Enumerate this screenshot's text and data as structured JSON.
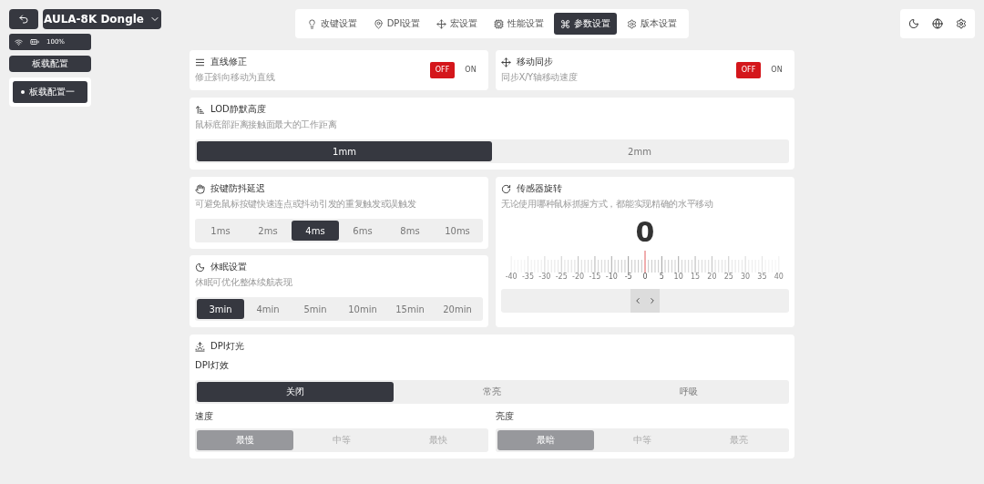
{
  "header": {
    "device": "AULA-8K Dongle",
    "battery": "100%"
  },
  "sidebar": {
    "button": "板载配置",
    "items": [
      {
        "label": "板载配置一",
        "selected": true
      }
    ]
  },
  "nav": [
    {
      "label": "改键设置",
      "selected": false
    },
    {
      "label": "DPI设置",
      "selected": false
    },
    {
      "label": "宏设置",
      "selected": false
    },
    {
      "label": "性能设置",
      "selected": false
    },
    {
      "label": "参数设置",
      "selected": true
    },
    {
      "label": "版本设置",
      "selected": false
    }
  ],
  "toggles": [
    {
      "title": "直线修正",
      "description": "修正斜向移动为直线",
      "options": [
        {
          "label": "OFF",
          "selected": true
        },
        {
          "label": "ON",
          "selected": false
        }
      ]
    },
    {
      "title": "移动同步",
      "description": "同步X/Y轴移动速度",
      "options": [
        {
          "label": "OFF",
          "selected": true
        },
        {
          "label": "ON",
          "selected": false
        }
      ]
    }
  ],
  "lod": {
    "title": "LOD静默高度",
    "description": "鼠标底部距离接触面最大的工作距离",
    "options": [
      {
        "label": "1mm",
        "selected": true
      },
      {
        "label": "2mm",
        "selected": false
      }
    ]
  },
  "debounce": {
    "title": "按键防抖延迟",
    "description": "可避免鼠标按键快速连点或抖动引发的重复触发或误触发",
    "options": [
      {
        "label": "1ms",
        "selected": false
      },
      {
        "label": "2ms",
        "selected": false
      },
      {
        "label": "4ms",
        "selected": true
      },
      {
        "label": "6ms",
        "selected": false
      },
      {
        "label": "8ms",
        "selected": false
      },
      {
        "label": "10ms",
        "selected": false
      }
    ]
  },
  "sleep": {
    "title": "休眠设置",
    "description": "休眠可优化整体续航表现",
    "options": [
      {
        "label": "3min",
        "selected": true
      },
      {
        "label": "4min",
        "selected": false
      },
      {
        "label": "5min",
        "selected": false
      },
      {
        "label": "10min",
        "selected": false
      },
      {
        "label": "15min",
        "selected": false
      },
      {
        "label": "20min",
        "selected": false
      }
    ]
  },
  "sensor": {
    "title": "传感器旋转",
    "description": "无论使用哪种鼠标抓握方式，都能实现精确的水平移动",
    "value": "0",
    "scale": [
      "-40",
      "-35",
      "-30",
      "-25",
      "-20",
      "-15",
      "-10",
      "-5",
      "0",
      "5",
      "10",
      "15",
      "20",
      "25",
      "30",
      "35",
      "40"
    ]
  },
  "dpi_light": {
    "title": "DPI灯光",
    "effect": {
      "label": "DPI灯效",
      "options": [
        {
          "label": "关闭",
          "selected": true
        },
        {
          "label": "常亮",
          "selected": false
        },
        {
          "label": "呼吸",
          "selected": false
        }
      ]
    },
    "groups": [
      {
        "label": "速度",
        "disabled": true,
        "options": [
          {
            "label": "最慢",
            "selected": true
          },
          {
            "label": "中等",
            "selected": false
          },
          {
            "label": "最快",
            "selected": false
          }
        ]
      },
      {
        "label": "亮度",
        "disabled": true,
        "options": [
          {
            "label": "最暗",
            "selected": true
          },
          {
            "label": "中等",
            "selected": false
          },
          {
            "label": "最亮",
            "selected": false
          }
        ]
      }
    ]
  }
}
